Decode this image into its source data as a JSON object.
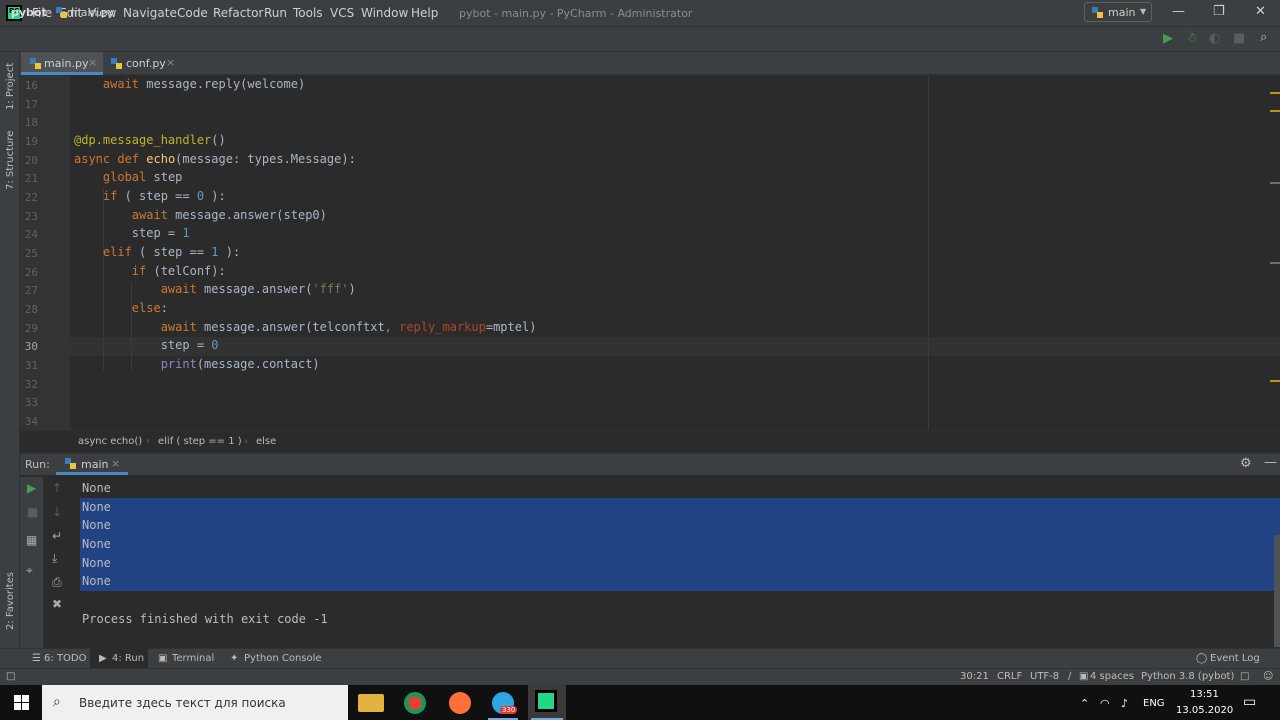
{
  "window": {
    "menu": [
      "File",
      "Edit",
      "View",
      "Navigate",
      "Code",
      "Refactor",
      "Run",
      "Tools",
      "VCS",
      "Window",
      "Help"
    ],
    "title": "pybot - main.py - PyCharm - Administrator"
  },
  "navbar": {
    "project": "pybot",
    "file": "main.py",
    "run_config": "main"
  },
  "side_labels": {
    "project": "1: Project",
    "structure": "7: Structure",
    "favorites": "2: Favorites"
  },
  "tabs": [
    {
      "label": "main.py",
      "active": true
    },
    {
      "label": "conf.py",
      "active": false
    }
  ],
  "editor": {
    "line_numbers": [
      "16",
      "17",
      "18",
      "19",
      "20",
      "21",
      "22",
      "23",
      "24",
      "25",
      "26",
      "27",
      "28",
      "29",
      "30",
      "31",
      "32",
      "33",
      "34"
    ],
    "current_line": "30"
  },
  "breadcrumbs": [
    "async echo()",
    "elif ( step == 1 )",
    "else"
  ],
  "run_panel": {
    "label": "Run:",
    "tab": "main",
    "output": [
      "None",
      "None",
      "None",
      "None",
      "None",
      "None"
    ],
    "finish": "Process finished with exit code -1"
  },
  "tool_windows": {
    "todo": "6: TODO",
    "run": "4: Run",
    "terminal": "Terminal",
    "python_console": "Python Console",
    "event_log": "Event Log"
  },
  "status": {
    "position": "30:21",
    "line_sep": "CRLF",
    "encoding": "UTF-8",
    "indent": "4 spaces",
    "interpreter": "Python 3.8 (pybot)"
  },
  "taskbar": {
    "search_placeholder": "Введите здесь текст для поиска",
    "lang": "ENG",
    "time": "13:51",
    "date": "13.05.2020",
    "telegram_badge": "330"
  },
  "colors": {
    "accent": "#4a88c7",
    "selection": "#214283",
    "run_green": "#499c54"
  }
}
